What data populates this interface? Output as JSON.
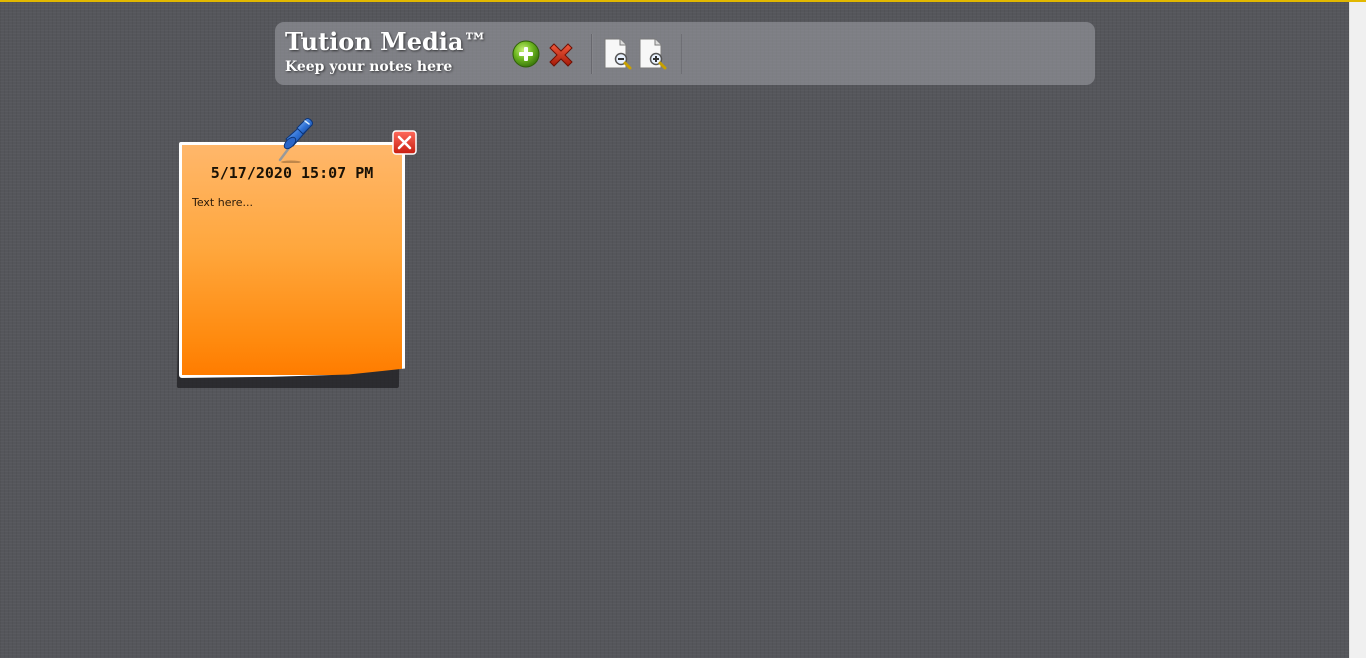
{
  "header": {
    "title": "Tution Media™",
    "subtitle": "Keep your notes here"
  },
  "toolbar": {
    "add_icon": "add-circle-icon",
    "delete_icon": "delete-x-icon",
    "zoom_out_icon": "document-zoom-out-icon",
    "zoom_in_icon": "document-zoom-in-icon"
  },
  "note": {
    "date": "5/17/2020 15:07 PM",
    "placeholder": "Text here...",
    "pin_icon": "pushpin-icon",
    "close_icon": "close-icon",
    "color": "#ff8a0e"
  },
  "colors": {
    "background": "#55565b",
    "accent_border": "#e2b800"
  }
}
